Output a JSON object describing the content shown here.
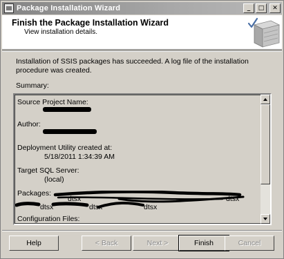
{
  "window": {
    "title": "Package Installation Wizard",
    "controls": [
      "_",
      "□",
      "✕"
    ]
  },
  "header": {
    "title": "Finish the Package Installation Wizard",
    "subtitle": "View installation details."
  },
  "message": "Installation of SSIS packages has succeeded. A log file of the installation procedure was created.",
  "summary": {
    "label": "Summary:",
    "lines": {
      "source_label": "Source Project Name:",
      "author_label": "Author:",
      "deploy_label": "Deployment Utility created at:",
      "deploy_value": "5/18/2011 1:34:39 AM",
      "target_label": "Target SQL Server:",
      "target_value": "(local)",
      "packages_label": "Packages:",
      "pkg_row1_a": "dtsx",
      "pkg_row1_b": "dtsx",
      "pkg_row2_a": "dtsx",
      "pkg_row2_b": "dtsx",
      "pkg_row2_c": "dtsx",
      "config_label": "Configuration Files:"
    }
  },
  "buttons": {
    "help": "Help",
    "back": "< Back",
    "next": "Next >",
    "finish": "Finish",
    "cancel": "Cancel"
  }
}
